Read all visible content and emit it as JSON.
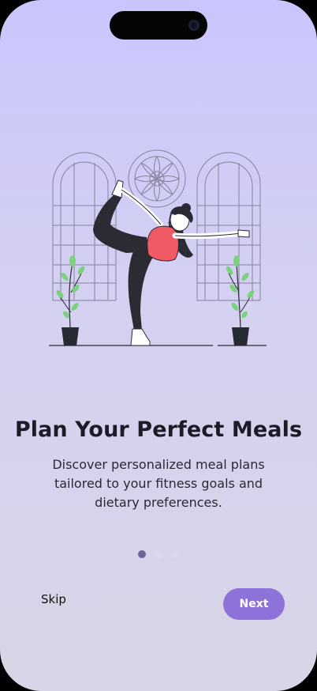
{
  "onboarding": {
    "title": "Plan Your Perfect Meals",
    "description": "Discover personalized meal plans tailored to your fitness goals and dietary preferences.",
    "page_indicator": {
      "total": 3,
      "active_index": 0
    },
    "skip_label": "Skip",
    "next_label": "Next"
  },
  "illustration": {
    "subject": "woman-yoga-dancer-pose",
    "icons": [
      "arched-window-icon",
      "mandala-icon",
      "potted-plant-icon"
    ]
  },
  "colors": {
    "background_top": "#cac6fd",
    "background_bottom": "#d9d5e6",
    "primary_button": "#8f72d9",
    "active_dot": "#6f639a",
    "inactive_dot": "#dcd8ea",
    "top_accent": "#f05a64",
    "title_text": "#1d1b26"
  }
}
